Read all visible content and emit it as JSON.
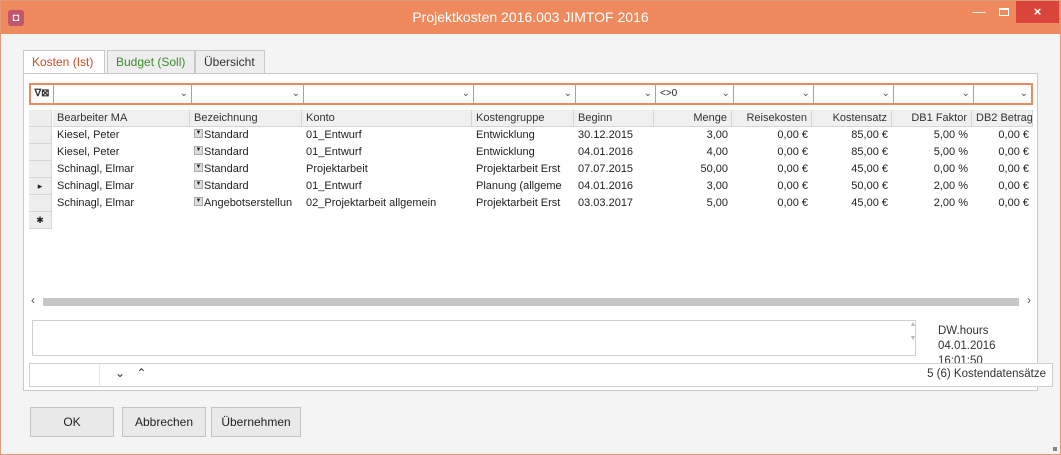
{
  "window": {
    "title": "Projektkosten 2016.003 JIMTOF 2016",
    "icon_glyph": "◘",
    "accent_color": "#ee8a5e",
    "close_glyph": "×",
    "minimize_glyph": "—"
  },
  "tabs": [
    {
      "label": "Kosten (Ist)",
      "active": true
    },
    {
      "label": "Budget (Soll)",
      "active": false
    },
    {
      "label": "Übersicht",
      "active": false
    }
  ],
  "filter": {
    "icons": "∇⊠",
    "dropdown_glyph": "⌄",
    "menge_filter": "<>0"
  },
  "columns": [
    "Bearbeiter MA",
    "Bezeichnung",
    "Konto",
    "Kostengruppe",
    "Beginn",
    "Menge",
    "Reisekosten",
    "Kostensatz",
    "DB1 Faktor",
    "DB2 Betrag"
  ],
  "rows": [
    {
      "ma": "Kiesel, Peter",
      "bez": "Standard",
      "konto": "01_Entwurf",
      "gruppe": "Entwicklung",
      "beginn": "30.12.2015",
      "menge": "3,00",
      "reise": "0,00 €",
      "satz": "85,00 €",
      "db1": "5,00 %",
      "db2": "0,00 €"
    },
    {
      "ma": "Kiesel, Peter",
      "bez": "Standard",
      "konto": "01_Entwurf",
      "gruppe": "Entwicklung",
      "beginn": "04.01.2016",
      "menge": "4,00",
      "reise": "0,00 €",
      "satz": "85,00 €",
      "db1": "5,00 %",
      "db2": "0,00 €"
    },
    {
      "ma": "Schinagl, Elmar",
      "bez": "Standard",
      "konto": "Projektarbeit",
      "gruppe": "Projektarbeit Erst",
      "beginn": "07.07.2015",
      "menge": "50,00",
      "reise": "0,00 €",
      "satz": "45,00 €",
      "db1": "0,00 %",
      "db2": "0,00 €"
    },
    {
      "ma": "Schinagl, Elmar",
      "bez": "Standard",
      "konto": "01_Entwurf",
      "gruppe": "Planung (allgeme",
      "beginn": "04.01.2016",
      "menge": "3,00",
      "reise": "0,00 €",
      "satz": "50,00 €",
      "db1": "2,00 %",
      "db2": "0,00 €"
    },
    {
      "ma": "Schinagl, Elmar",
      "bez": "Angebotserstellun",
      "konto": "02_Projektarbeit allgemein",
      "gruppe": "Projektarbeit Erst",
      "beginn": "03.03.2017",
      "menge": "5,00",
      "reise": "0,00 €",
      "satz": "45,00 €",
      "db1": "2,00 %",
      "db2": "0,00 €"
    }
  ],
  "current_row_marker": "▸",
  "new_row_marker": "✱",
  "scroll": {
    "left": "‹",
    "right": "›"
  },
  "meta": {
    "user": "DW.hours",
    "timestamp": "04.01.2016 16:01:50"
  },
  "navigation": {
    "arrows": "⌄ ⌃",
    "record_count": "5 (6) Kostendatensätze"
  },
  "buttons": {
    "ok": "OK",
    "cancel": "Abbrechen",
    "apply": "Übernehmen"
  }
}
